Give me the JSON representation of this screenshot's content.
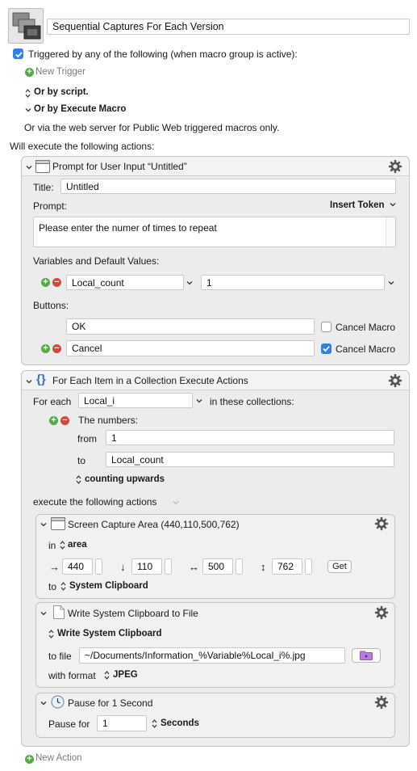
{
  "macro": {
    "name": "Sequential Captures For Each Version",
    "trigger_label": "Triggered by any of the following (when macro group is active):",
    "new_trigger": "New Trigger",
    "or_by_script": "Or by script.",
    "or_by_execute_macro": "Or by Execute Macro",
    "web_server_text": "Or via the web server for Public Web triggered macros only.",
    "will_execute": "Will execute the following actions:",
    "new_action": "New Action"
  },
  "prompt_action": {
    "header": "Prompt for User Input “Untitled”",
    "title_label": "Title:",
    "title_value": "Untitled",
    "prompt_label": "Prompt:",
    "insert_token": "Insert Token",
    "prompt_text": "Please enter the numer of times to repeat",
    "variables_label": "Variables and Default Values:",
    "variable_name": "Local_count",
    "variable_default": "1",
    "buttons_label": "Buttons:",
    "buttons": [
      {
        "label": "OK",
        "cancel_macro": false
      },
      {
        "label": "Cancel",
        "cancel_macro": true
      }
    ],
    "cancel_macro_label": "Cancel Macro"
  },
  "foreach_action": {
    "header": "For Each Item in a Collection Execute Actions",
    "for_each_label": "For each",
    "variable": "Local_i",
    "in_collections": "in these collections:",
    "numbers_label": "The numbers:",
    "from_label": "from",
    "from_value": "1",
    "to_label": "to",
    "to_value": "Local_count",
    "counting": "counting upwards",
    "execute_label": "execute the following actions"
  },
  "capture_action": {
    "header": "Screen Capture Area (440,110,500,762)",
    "in_label": "in",
    "area": "area",
    "left": "440",
    "top": "110",
    "width": "500",
    "height": "762",
    "get_button": "Get",
    "to_label": "to",
    "destination": "System Clipboard",
    "arrows": {
      "left": "→",
      "top": "↓",
      "width": "↔",
      "height": "↕"
    }
  },
  "write_action": {
    "header": "Write System Clipboard to File",
    "source": "Write System Clipboard",
    "to_file_label": "to file",
    "path": "~/Documents/Information_%Variable%Local_i%.jpg",
    "format_label": "with format",
    "format": "JPEG"
  },
  "pause_action": {
    "header": "Pause for 1 Second",
    "pause_label": "Pause for",
    "value": "1",
    "unit": "Seconds"
  },
  "colors": {
    "checkbox_accent": "#2f80ed",
    "add_green": "#4fae3f",
    "remove_red": "#d9443b",
    "folder_purple": "#b57be0",
    "foreach_blue": "#2f6fe0"
  }
}
